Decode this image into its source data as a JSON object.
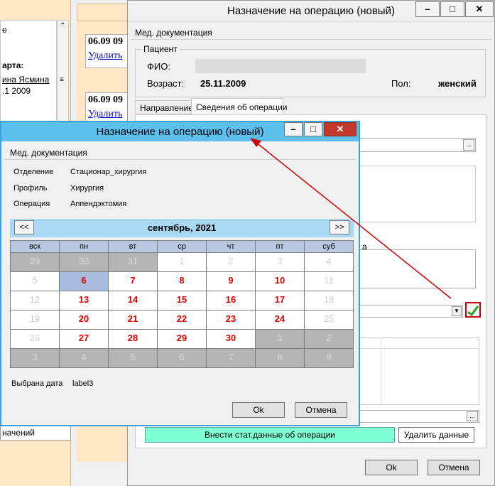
{
  "background": {
    "left_texts": [
      "е",
      "арта:",
      "ина Ясмина",
      ".1 2009"
    ],
    "cards": [
      {
        "date": "06.09 09",
        "link": "Удалить"
      },
      {
        "date": "06.09 09",
        "link": "Удалить"
      }
    ],
    "bottom_label": "начений"
  },
  "back_window": {
    "title": "Назначение на операцию (новый)",
    "menu": "Мед. документация",
    "patient_group": "Пациент",
    "fio_label": "ФИО:",
    "age_label": "Возраст:",
    "age_value": "25.11.2009",
    "sex_label": "Пол:",
    "sex_value": "женский",
    "tabs": [
      "Направление",
      "Сведения об операции"
    ],
    "partial_label": "а",
    "browse_label": "...",
    "stat_button": "Внести стат.данные об операции",
    "delete_button": "Удалить данные",
    "ok": "Ok",
    "cancel": "Отмена"
  },
  "front_window": {
    "title": "Назначение на операцию (новый)",
    "menu": "Мед. документация",
    "fields": [
      {
        "label": "Отделение",
        "value": "Стационар_хирургия"
      },
      {
        "label": "Профиль",
        "value": "Хирургия"
      },
      {
        "label": "Операция",
        "value": "Аппендэктомия"
      }
    ],
    "calendar": {
      "month": "сентябрь, 2021",
      "prev": "<<",
      "next": ">>",
      "weekdays": [
        "вск",
        "пн",
        "вт",
        "ср",
        "чт",
        "пт",
        "суб"
      ],
      "weeks": [
        [
          {
            "d": "29",
            "s": "gray"
          },
          {
            "d": "30",
            "s": "gray"
          },
          {
            "d": "31",
            "s": "gray"
          },
          {
            "d": "1",
            "s": "white"
          },
          {
            "d": "2",
            "s": "white"
          },
          {
            "d": "3",
            "s": "white"
          },
          {
            "d": "4",
            "s": "white"
          }
        ],
        [
          {
            "d": "5",
            "s": "white"
          },
          {
            "d": "6",
            "s": "selected"
          },
          {
            "d": "7",
            "s": "active"
          },
          {
            "d": "8",
            "s": "active"
          },
          {
            "d": "9",
            "s": "active"
          },
          {
            "d": "10",
            "s": "active"
          },
          {
            "d": "11",
            "s": "white"
          }
        ],
        [
          {
            "d": "12",
            "s": "white"
          },
          {
            "d": "13",
            "s": "active"
          },
          {
            "d": "14",
            "s": "active"
          },
          {
            "d": "15",
            "s": "active"
          },
          {
            "d": "16",
            "s": "active"
          },
          {
            "d": "17",
            "s": "active"
          },
          {
            "d": "18",
            "s": "white"
          }
        ],
        [
          {
            "d": "19",
            "s": "white"
          },
          {
            "d": "20",
            "s": "active"
          },
          {
            "d": "21",
            "s": "active"
          },
          {
            "d": "22",
            "s": "active"
          },
          {
            "d": "23",
            "s": "active"
          },
          {
            "d": "24",
            "s": "active"
          },
          {
            "d": "25",
            "s": "white"
          }
        ],
        [
          {
            "d": "26",
            "s": "white"
          },
          {
            "d": "27",
            "s": "active"
          },
          {
            "d": "28",
            "s": "active"
          },
          {
            "d": "29",
            "s": "active"
          },
          {
            "d": "30",
            "s": "active"
          },
          {
            "d": "1",
            "s": "gray"
          },
          {
            "d": "2",
            "s": "gray"
          }
        ],
        [
          {
            "d": "3",
            "s": "gray"
          },
          {
            "d": "4",
            "s": "gray"
          },
          {
            "d": "5",
            "s": "gray"
          },
          {
            "d": "6",
            "s": "gray"
          },
          {
            "d": "7",
            "s": "gray"
          },
          {
            "d": "8",
            "s": "gray"
          },
          {
            "d": "9",
            "s": "gray"
          }
        ]
      ]
    },
    "selected_date_label": "Выбрана дата",
    "selected_date_value": "label3",
    "ok": "Ok",
    "cancel": "Отмена"
  },
  "colors": {
    "arrow": "#cc0000",
    "front_titlebar": "#5bc0ee",
    "calendar_header": "#a9d8f3",
    "stat_button": "#7fffd4",
    "close_button": "#c0392b"
  }
}
